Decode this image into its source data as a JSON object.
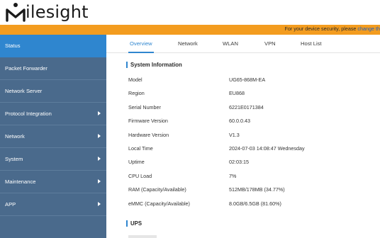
{
  "brand": {
    "name": "Milesight",
    "logo_icon": "milesight-logo"
  },
  "notice": {
    "text": "For your device security, please",
    "link": "change th"
  },
  "sidebar": {
    "items": [
      {
        "label": "Status",
        "active": true,
        "has_arrow": false
      },
      {
        "label": "Packet Forwarder",
        "active": false,
        "has_arrow": false
      },
      {
        "label": "Network Server",
        "active": false,
        "has_arrow": false
      },
      {
        "label": "Protocol Integration",
        "active": false,
        "has_arrow": true
      },
      {
        "label": "Network",
        "active": false,
        "has_arrow": true
      },
      {
        "label": "System",
        "active": false,
        "has_arrow": true
      },
      {
        "label": "Maintenance",
        "active": false,
        "has_arrow": true
      },
      {
        "label": "APP",
        "active": false,
        "has_arrow": true
      }
    ]
  },
  "tabs": [
    {
      "label": "Overview",
      "active": true
    },
    {
      "label": "Network",
      "active": false
    },
    {
      "label": "WLAN",
      "active": false
    },
    {
      "label": "VPN",
      "active": false
    },
    {
      "label": "Host List",
      "active": false
    }
  ],
  "system_info": {
    "title": "System Information",
    "rows": [
      {
        "label": "Model",
        "value": "UG65-868M-EA"
      },
      {
        "label": "Region",
        "value": "EU868"
      },
      {
        "label": "Serial Number",
        "value": "6221E0171384"
      },
      {
        "label": "Firmware Version",
        "value": "60.0.0.43"
      },
      {
        "label": "Hardware Version",
        "value": "V1.3"
      },
      {
        "label": "Local Time",
        "value": "2024-07-03 14:08:47 Wednesday"
      },
      {
        "label": "Uptime",
        "value": "02:03:15"
      },
      {
        "label": "CPU Load",
        "value": "7%"
      },
      {
        "label": "RAM (Capacity/Available)",
        "value": "512MB/178MB (34.77%)"
      },
      {
        "label": "eMMC (Capacity/Available)",
        "value": "8.0GB/6.5GB (81.60%)"
      }
    ]
  },
  "ups": {
    "title": "UPS"
  },
  "colors": {
    "accent": "#2f86cf",
    "sidebar": "#4a6a8c",
    "notice_bar": "#f39c1f"
  }
}
